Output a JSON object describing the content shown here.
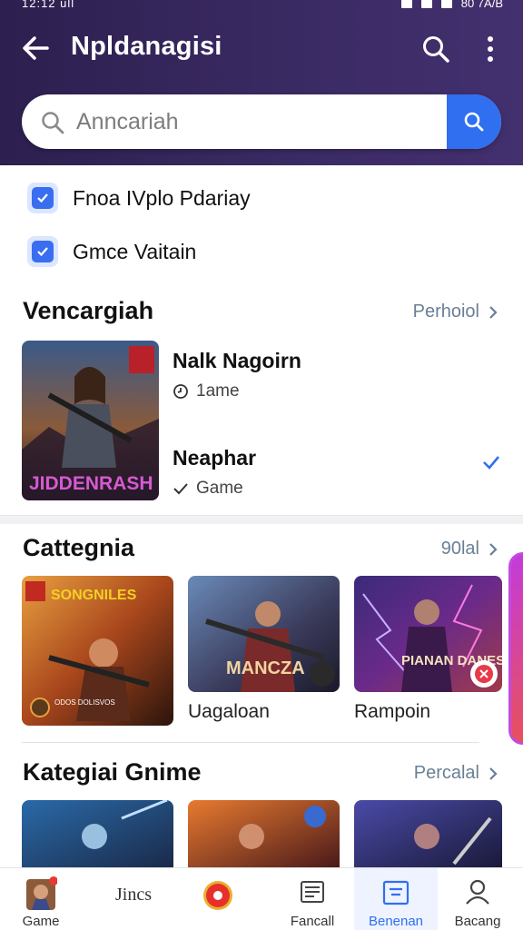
{
  "status": {
    "time": "12:12 ull",
    "battery": "80 7A/B"
  },
  "header": {
    "title": "Npldanagisi"
  },
  "search": {
    "placeholder": "Anncariah"
  },
  "filters": [
    {
      "label": "Fnoa IVplo Pdariay",
      "checked": true
    },
    {
      "label": "Gmce Vaitain",
      "checked": true
    }
  ],
  "featured": {
    "title": "Vencargiah",
    "link": "Perhoiol",
    "image_caption": "JIDDENRASH",
    "items": [
      {
        "name": "Nalk Nagoirn",
        "meta": "1ame",
        "icon": "clock-icon"
      },
      {
        "name": "Neaphar",
        "meta": "Game",
        "icon": "check-small-icon"
      }
    ]
  },
  "category": {
    "title": "Cattegnia",
    "link": "90lal",
    "cards": [
      {
        "image_text": "SONGNILES",
        "sub_text": "ODOS DOLISVOS",
        "label": "",
        "color": "#c45a1a"
      },
      {
        "image_text": "MANCZA",
        "sub_text": "",
        "label": "Uagaloan",
        "color": "#3a4a6a"
      },
      {
        "image_text": "PIANAN DANES",
        "sub_text": "",
        "label": "Rampoin",
        "color": "#4a2a6a"
      }
    ]
  },
  "kategori": {
    "title": "Kategiai Gnime",
    "link": "Percalal"
  },
  "bottom_nav": [
    {
      "label": "Game",
      "icon": "game-avatar-icon",
      "active": false
    },
    {
      "label": "Jincs",
      "icon": "",
      "active": false
    },
    {
      "label": "",
      "icon": "record-icon",
      "active": false
    },
    {
      "label": "Fancall",
      "icon": "news-icon",
      "active": false
    },
    {
      "label": "Benenan",
      "icon": "tray-icon",
      "active": true
    },
    {
      "label": "Bacang",
      "icon": "profile-icon",
      "active": false
    }
  ],
  "colors": {
    "header": "#34265a",
    "accent": "#2f6ff0",
    "link": "#6a7f96"
  }
}
